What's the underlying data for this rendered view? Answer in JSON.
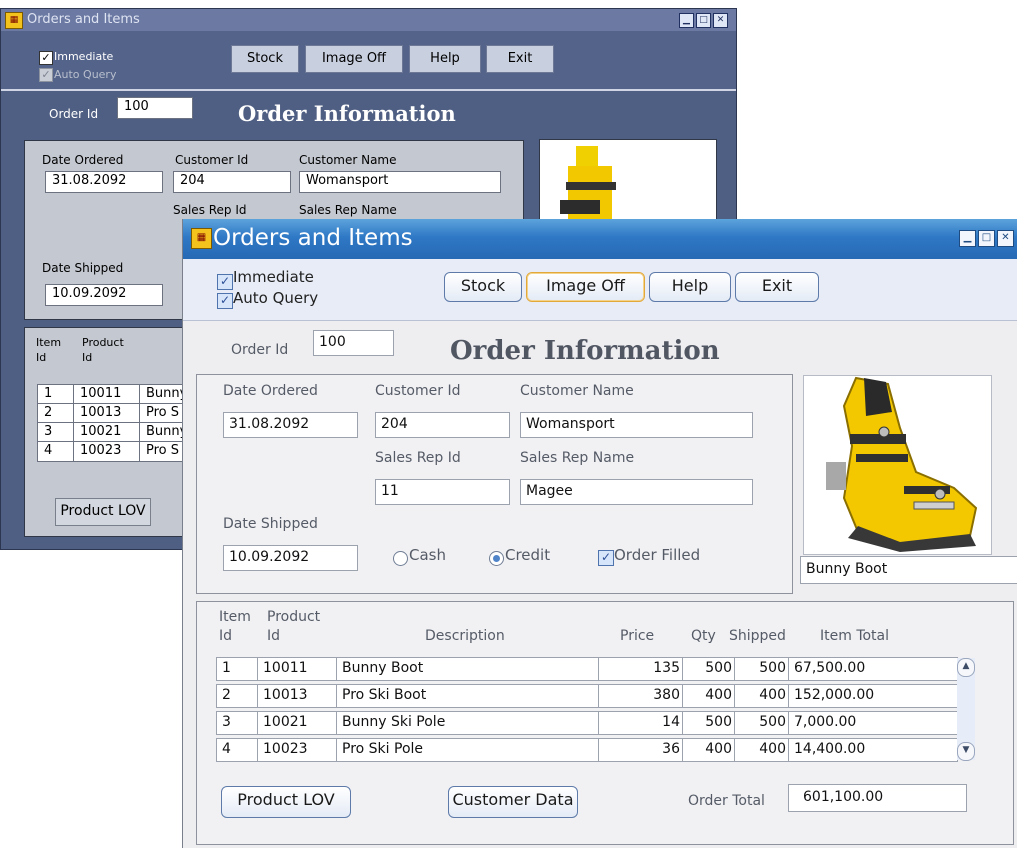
{
  "app": {
    "title": "Orders and Items",
    "window_buttons": [
      "▁",
      "□",
      "✕"
    ]
  },
  "back_window": {
    "toolbar": {
      "immediate_label": "Immediate",
      "auto_query_label": "Auto Query",
      "buttons": [
        "Stock",
        "Image Off",
        "Help",
        "Exit"
      ]
    },
    "order_id_label": "Order Id",
    "order_id_value": "100",
    "header_title": "Order Information",
    "labels": {
      "date_ordered": "Date Ordered",
      "customer_id": "Customer Id",
      "customer_name": "Customer Name",
      "sales_rep_id": "Sales Rep Id",
      "sales_rep_name": "Sales Rep Name",
      "date_shipped": "Date Shipped",
      "item_id": "Item\nId",
      "product_id": "Product\nId"
    },
    "values": {
      "date_ordered": "31.08.2092",
      "customer_id": "204",
      "customer_name": "Womansport",
      "date_shipped": "10.09.2092"
    },
    "items": [
      {
        "item": "1",
        "product": "10011",
        "desc": "Bunny"
      },
      {
        "item": "2",
        "product": "10013",
        "desc": "Pro S"
      },
      {
        "item": "3",
        "product": "10021",
        "desc": "Bunny"
      },
      {
        "item": "4",
        "product": "10023",
        "desc": "Pro S"
      }
    ],
    "product_lov_label": "Product LOV"
  },
  "front_window": {
    "toolbar": {
      "immediate_label": "Immediate",
      "auto_query_label": "Auto Query",
      "buttons": [
        "Stock",
        "Image Off",
        "Help",
        "Exit"
      ]
    },
    "order_id_label": "Order Id",
    "order_id_value": "100",
    "header_title": "Order Information",
    "labels": {
      "date_ordered": "Date Ordered",
      "customer_id": "Customer Id",
      "customer_name": "Customer Name",
      "sales_rep_id": "Sales Rep Id",
      "sales_rep_name": "Sales Rep Name",
      "date_shipped": "Date Shipped",
      "cash": "Cash",
      "credit": "Credit",
      "order_filled": "Order Filled"
    },
    "values": {
      "date_ordered": "31.08.2092",
      "customer_id": "204",
      "customer_name": "Womansport",
      "sales_rep_id": "11",
      "sales_rep_name": "Magee",
      "date_shipped": "10.09.2092",
      "product_caption": "Bunny Boot"
    },
    "items_table": {
      "headers": {
        "item_id_1": "Item",
        "item_id_2": "Id",
        "product_id_1": "Product",
        "product_id_2": "Id",
        "description": "Description",
        "price": "Price",
        "qty": "Qty",
        "shipped": "Shipped",
        "item_total": "Item Total"
      },
      "rows": [
        {
          "item": "1",
          "product": "10011",
          "desc": "Bunny Boot",
          "price": "135",
          "qty": "500",
          "shipped": "500",
          "total": "67,500.00"
        },
        {
          "item": "2",
          "product": "10013",
          "desc": "Pro Ski Boot",
          "price": "380",
          "qty": "400",
          "shipped": "400",
          "total": "152,000.00"
        },
        {
          "item": "3",
          "product": "10021",
          "desc": "Bunny Ski Pole",
          "price": "14",
          "qty": "500",
          "shipped": "500",
          "total": "7,000.00"
        },
        {
          "item": "4",
          "product": "10023",
          "desc": "Pro Ski Pole",
          "price": "36",
          "qty": "400",
          "shipped": "400",
          "total": "14,400.00"
        }
      ]
    },
    "product_lov_label": "Product LOV",
    "customer_data_label": "Customer Data",
    "order_total_label": "Order Total",
    "order_total_value": "601,100.00"
  }
}
